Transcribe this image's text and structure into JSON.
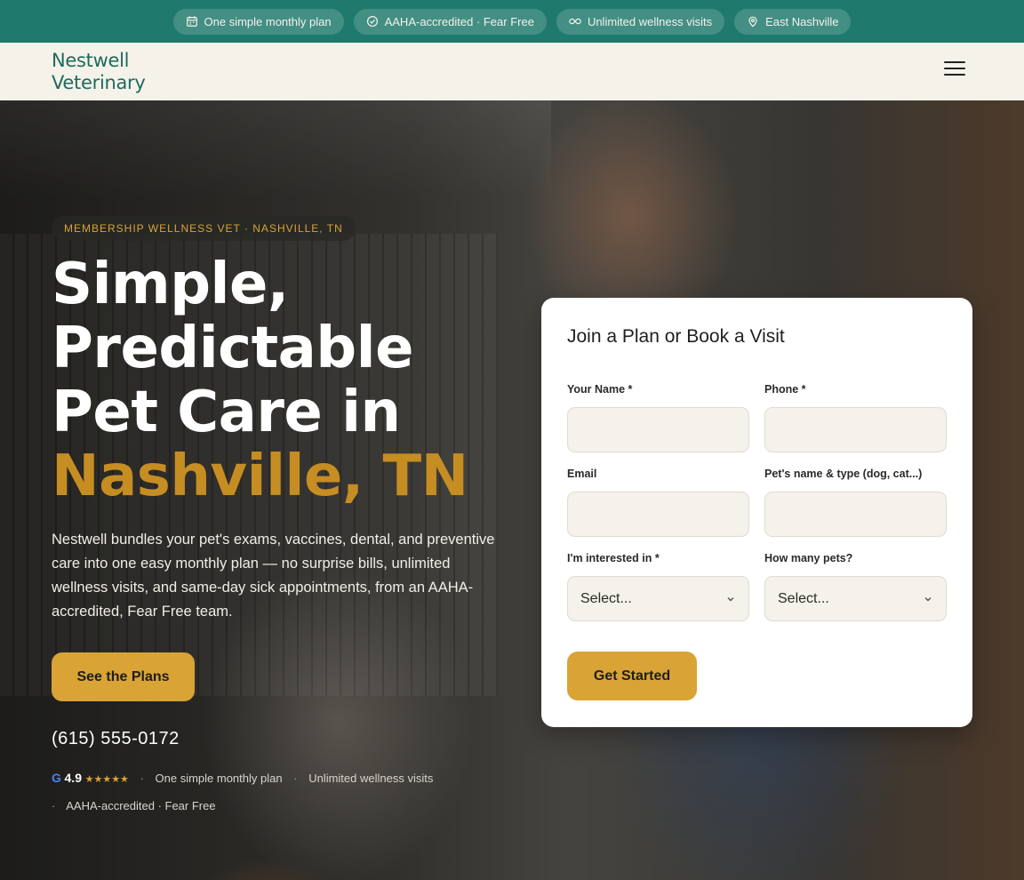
{
  "topbar": {
    "pills": [
      {
        "label": "One simple monthly plan",
        "icon": "calendar-icon"
      },
      {
        "label": "AAHA-accredited · Fear Free",
        "icon": "check-circle-icon"
      },
      {
        "label": "Unlimited wellness visits",
        "icon": "infinity-icon"
      },
      {
        "label": "East Nashville",
        "icon": "map-pin-icon"
      }
    ]
  },
  "header": {
    "logo_line1": "Nestwell",
    "logo_line2": "Veterinary",
    "menu_icon": "hamburger-menu-icon"
  },
  "hero": {
    "eyebrow": "MEMBERSHIP WELLNESS VET · NASHVILLE, TN",
    "headline_line1": "Simple,",
    "headline_line2": "Predictable",
    "headline_line3": "Pet Care in",
    "headline_highlight": "Nashville, TN",
    "lede": "Nestwell bundles your pet's exams, vaccines, dental, and preventive care into one easy monthly plan — no surprise bills, unlimited wellness visits, and same-day sick appointments, from an AAHA-accredited, Fear Free team.",
    "cta_label": "See the Plans",
    "phone": "(615) 555-0172",
    "proof": {
      "google_letter": "G",
      "rating": "4.9",
      "stars": "★★★★★",
      "item1": "One simple monthly plan",
      "item2": "Unlimited wellness visits",
      "item3": "AAHA-accredited · Fear Free",
      "separator": "·"
    }
  },
  "form": {
    "title": "Join a Plan or Book a Visit",
    "name_label": "Your Name *",
    "phone_label": "Phone *",
    "email_label": "Email",
    "pet_label": "Pet's name & type (dog, cat...)",
    "interest_label": "I'm interested in *",
    "interest_value": "Select...",
    "pets_label": "How many pets?",
    "pets_value": "Select...",
    "submit_label": "Get Started"
  },
  "colors": {
    "topbar": "#1f7a6d",
    "header_bg": "#f5f2ea",
    "accent_gold": "#d9a336",
    "headline_gold": "#c68d23",
    "logo_green": "#1d6b5e"
  }
}
